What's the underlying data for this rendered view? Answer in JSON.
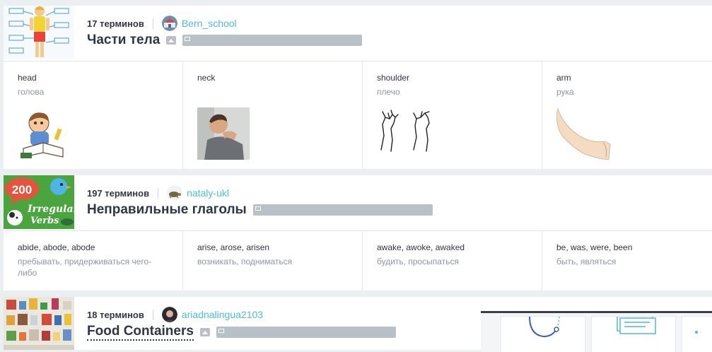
{
  "colors": {
    "accent": "#4fbcd0",
    "text": "#303545",
    "muted": "#8c96a3",
    "background": "#eceff2"
  },
  "sets": [
    {
      "term_count": "17 терминов",
      "author": "Bern_school",
      "title": "Части тела",
      "cards": [
        {
          "term": "head",
          "definition": "голова",
          "image": "boy-reading-head-illustration"
        },
        {
          "term": "neck",
          "definition": "",
          "image": "man-holding-neck-photo"
        },
        {
          "term": "shoulder",
          "definition": "плечо",
          "image": "shoulder-sketch"
        },
        {
          "term": "arm",
          "definition": "рука",
          "image": "arm-photo"
        }
      ]
    },
    {
      "term_count": "197 терминов",
      "author": "nataly-ukl",
      "title": "Неправильные глаголы",
      "thumb_text": {
        "number": "200",
        "line1": "Irregular",
        "line2": "Verbs"
      },
      "cards": [
        {
          "term": "abide, abode, abode",
          "definition": "пребывать, придерживаться чего-либо"
        },
        {
          "term": "arise, arose, arisen",
          "definition": "возникать, подниматься"
        },
        {
          "term": "awake, awoke, awaked",
          "definition": "будить, просыпаться"
        },
        {
          "term": "be, was, were, been",
          "definition": "быть, являться"
        }
      ]
    },
    {
      "term_count": "18 терминов",
      "author": "ariadnalingua2103",
      "title": "Food Containers",
      "cards": []
    }
  ]
}
